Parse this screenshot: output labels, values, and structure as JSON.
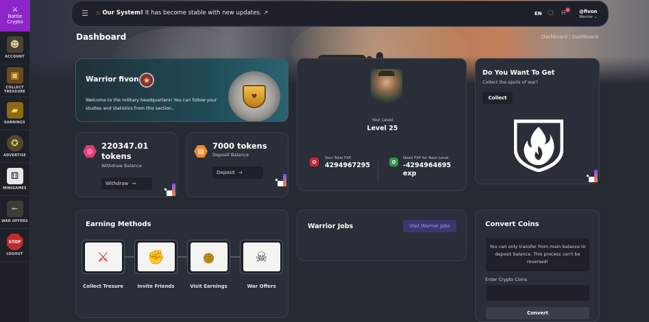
{
  "brand": {
    "name": "Battle Crypto"
  },
  "sidebar": {
    "items": [
      {
        "label": "ACCOUNT",
        "icon": "soldier-icon"
      },
      {
        "label": "COLLECT TREASURE",
        "icon": "treasure-chest-icon"
      },
      {
        "label": "EARNINGS",
        "icon": "gold-bar-icon"
      },
      {
        "label": "ADVERTISE",
        "icon": "medal-icon"
      },
      {
        "label": "MINIGAMES",
        "icon": "dice-icon"
      },
      {
        "label": "WAR OFFERS",
        "icon": "rifle-icon"
      },
      {
        "label": "LOGOUT",
        "icon": "stop-sign-icon"
      }
    ]
  },
  "topbar": {
    "announcement_highlight": "Our System!",
    "announcement_text": " It has become stable with new updates.",
    "language": "EN",
    "notification_count": "0",
    "username": "@fivon",
    "role": "Warrior"
  },
  "header": {
    "title": "Dashboard",
    "breadcrumb": "Dashboard / Dashboard"
  },
  "welcome": {
    "title": "Warrior fivon",
    "text": "Welcome to the military headquarters! You can follow your studies and statistics from this section.."
  },
  "withdraw": {
    "amount": "220347.01 tokens",
    "label": "Withdraw Balance",
    "button": "Withdraw"
  },
  "deposit": {
    "amount": "7000 tokens",
    "label": "Deposit Balance",
    "button": "Deposit"
  },
  "level": {
    "label": "Your Level",
    "value": "Level 25",
    "total_fxp_label": "Your Total FXP",
    "total_fxp": "4294967295",
    "need_fxp_label": "Need FXP for Next Level",
    "need_fxp": "-4294964695 exp"
  },
  "collect": {
    "title": "Do You Want To Get",
    "subtitle": "Collect the spoils of war?",
    "button": "Collect"
  },
  "earning_methods": {
    "title": "Earning Methods",
    "items": [
      {
        "label": "Collect Tresure",
        "icon": "crossed-swords-icon"
      },
      {
        "label": "Invite Friends",
        "icon": "handshake-icon"
      },
      {
        "label": "Visit Earnings",
        "icon": "bomb-icon"
      },
      {
        "label": "War Offers",
        "icon": "skull-icon"
      }
    ]
  },
  "jobs": {
    "title": "Warrior Jobs",
    "button": "Visit Warrior Jobs"
  },
  "convert": {
    "title": "Convert Coins",
    "note": "You can only transfer from main balance to deposit balance. This process can't be reversed!",
    "input_label": "Enter Crypto Coins",
    "input_placeholder": "",
    "button": "Convert"
  },
  "colors": {
    "brand": "#8e25c9",
    "card_bg": "#2a2e38",
    "page_bg": "#262a33",
    "accent_purple": "#a79cf5",
    "withdraw_icon": "#e23d75",
    "deposit_icon": "#f08a2a"
  }
}
